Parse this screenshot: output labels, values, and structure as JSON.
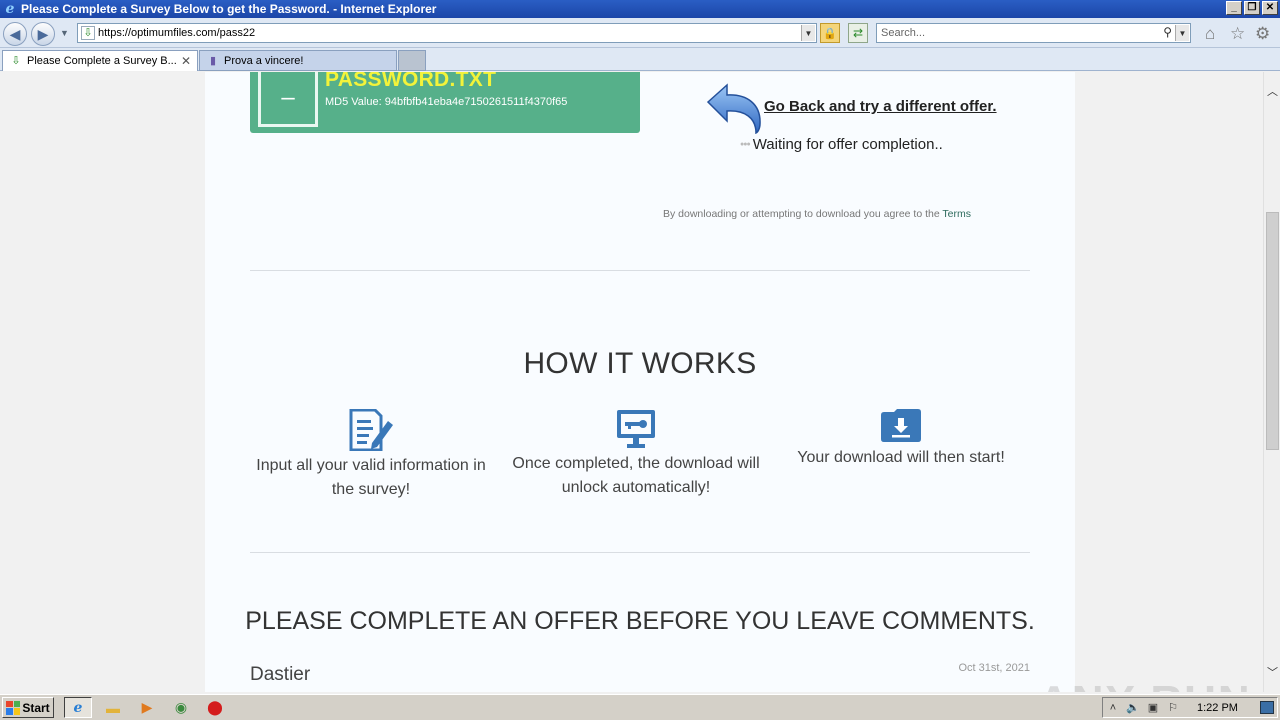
{
  "window": {
    "title": "Please Complete a Survey Below to get the Password. - Internet Explorer",
    "buttons": [
      "_",
      "❐",
      "✕"
    ]
  },
  "nav": {
    "url": "https://optimumfiles.com/pass22",
    "search_placeholder": "Search..."
  },
  "tabs": [
    {
      "label": "Please Complete a Survey B...",
      "active": true
    },
    {
      "label": "Prova a vincere!",
      "active": false
    }
  ],
  "file": {
    "name": "PASSWORD.TXT",
    "md5": "MD5 Value: 94bfbfb41eba4e7150261511f4370f65"
  },
  "offer": {
    "go_back": "Go Back and try a different offer.",
    "waiting": "Waiting for offer completion..",
    "agree_text": "By downloading or attempting to download you agree to the",
    "terms_link": "Terms"
  },
  "how": {
    "title": "HOW IT WORKS",
    "steps": [
      {
        "icon": "survey-form-icon",
        "text": "Input all your valid information in the survey!"
      },
      {
        "icon": "monitor-key-icon",
        "text": "Once completed, the download will unlock automatically!"
      },
      {
        "icon": "download-folder-icon",
        "text": "Your download will then start!"
      }
    ]
  },
  "comments": {
    "title": "PLEASE COMPLETE AN OFFER BEFORE YOU LEAVE COMMENTS.",
    "first": {
      "author": "Dastier",
      "date": "Oct 31st, 2021"
    }
  },
  "watermark": "ANY RUN",
  "taskbar": {
    "start": "Start",
    "clock": "1:22 PM"
  },
  "colors": {
    "card_green": "#56b08a",
    "filename_yellow": "#f3f33a",
    "icon_blue": "#3a78b8",
    "titlebar_blue": "#1c46a8"
  }
}
